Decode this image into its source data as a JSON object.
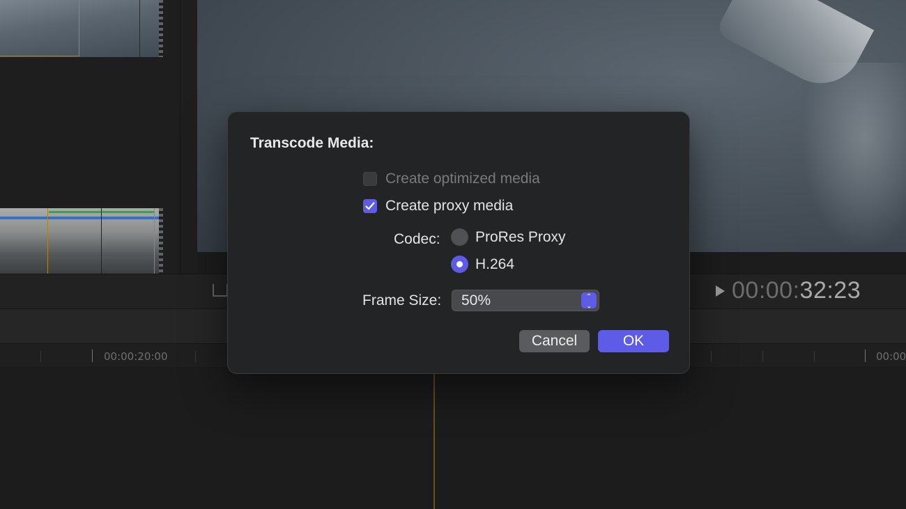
{
  "timecode": {
    "dim": "00:00:",
    "bright": "32:23"
  },
  "ruler": {
    "labels": [
      "00:00:20:00",
      "00:00"
    ]
  },
  "dialog": {
    "title": "Transcode Media:",
    "optimized_label": "Create optimized media",
    "optimized_checked": false,
    "optimized_enabled": false,
    "proxy_label": "Create proxy media",
    "proxy_checked": true,
    "codec_label": "Codec:",
    "codec_options": [
      "ProRes Proxy",
      "H.264"
    ],
    "codec_selected": "H.264",
    "frame_size_label": "Frame Size:",
    "frame_size_value": "50%",
    "cancel_label": "Cancel",
    "ok_label": "OK"
  },
  "colors": {
    "accent": "#5e5ce6",
    "dialog_bg": "#222426"
  },
  "icons": [
    "checkmark-icon",
    "play-icon",
    "stepper-icon",
    "radio-dot-icon"
  ]
}
